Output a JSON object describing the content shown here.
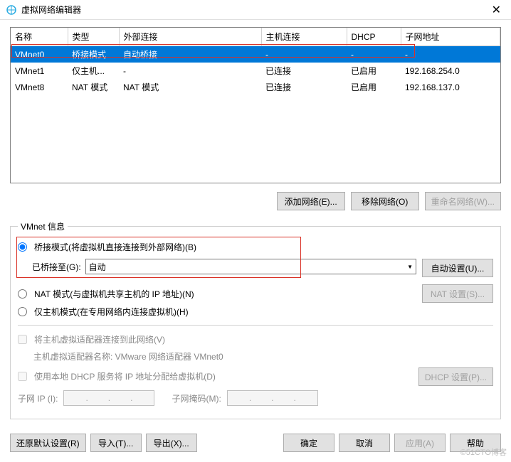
{
  "window": {
    "title": "虚拟网络编辑器",
    "close": "✕"
  },
  "table": {
    "headers": [
      "名称",
      "类型",
      "外部连接",
      "主机连接",
      "DHCP",
      "子网地址"
    ],
    "rows": [
      {
        "name": "VMnet0",
        "type": "桥接模式",
        "ext": "自动桥接",
        "host": "-",
        "dhcp": "-",
        "subnet": "-",
        "selected": true
      },
      {
        "name": "VMnet1",
        "type": "仅主机...",
        "ext": "-",
        "host": "已连接",
        "dhcp": "已启用",
        "subnet": "192.168.254.0"
      },
      {
        "name": "VMnet8",
        "type": "NAT 模式",
        "ext": "NAT 模式",
        "host": "已连接",
        "dhcp": "已启用",
        "subnet": "192.168.137.0"
      }
    ]
  },
  "buttons": {
    "add_network": "添加网络(E)...",
    "remove_network": "移除网络(O)",
    "rename_network": "重命名网络(W)..."
  },
  "vmnet_info": {
    "legend": "VMnet 信息",
    "bridged_radio": "桥接模式(将虚拟机直接连接到外部网络)(B)",
    "bridged_to_label": "已桥接至(G):",
    "bridged_to_value": "自动",
    "auto_settings": "自动设置(U)...",
    "nat_radio": "NAT 模式(与虚拟机共享主机的 IP 地址)(N)",
    "nat_settings": "NAT 设置(S)...",
    "hostonly_radio": "仅主机模式(在专用网络内连接虚拟机)(H)",
    "host_adapter_check": "将主机虚拟适配器连接到此网络(V)",
    "host_adapter_name": "主机虚拟适配器名称: VMware 网络适配器 VMnet0",
    "dhcp_check": "使用本地 DHCP 服务将 IP 地址分配给虚拟机(D)",
    "dhcp_settings": "DHCP 设置(P)...",
    "subnet_ip_label": "子网 IP (I):",
    "subnet_mask_label": "子网掩码(M):"
  },
  "footer": {
    "restore_defaults": "还原默认设置(R)",
    "import": "导入(T)...",
    "export": "导出(X)...",
    "ok": "确定",
    "cancel": "取消",
    "apply": "应用(A)",
    "help": "帮助"
  },
  "watermark": "©51CTO博客"
}
